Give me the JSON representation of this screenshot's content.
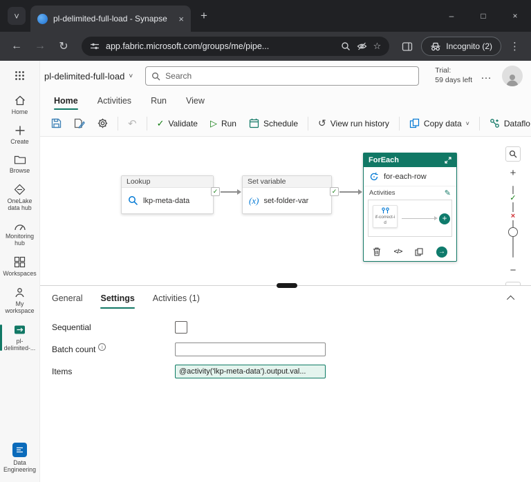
{
  "browser": {
    "tab_title": "pl-delimited-full-load - Synapse",
    "url": "app.fabric.microsoft.com/groups/me/pipe...",
    "incognito_label": "Incognito (2)"
  },
  "icons": {
    "tab_search_chevron": "˅",
    "tab_close": "×",
    "new_tab": "+",
    "window_minimize": "–",
    "window_maximize": "□",
    "window_close": "×",
    "back_arrow": "←",
    "forward_arrow": "→",
    "reload": "↻",
    "bookmark_star": "☆",
    "kebab_menu": "⋮",
    "title_chevron": "˅",
    "more_horizontal": "…",
    "undo": "↶",
    "validate_check": "✓",
    "run_play": "▷",
    "history_clock": "↺",
    "copy_chevron": "˅",
    "edit_pencil": "✎",
    "zoom_in": "+",
    "zoom_out": "−",
    "slider_check": "✓",
    "slider_x": "×",
    "port_check": "✓",
    "inner_plus": "+",
    "iterate_arrow": "→",
    "code_braces": "</>",
    "set_variable_glyph": "(x)",
    "info_i": "i"
  },
  "app_header": {
    "title": "pl-delimited-full-load",
    "search_placeholder": "Search",
    "trial_label": "Trial:",
    "trial_value": "59 days left"
  },
  "ribbon": {
    "tabs": [
      {
        "label": "Home"
      },
      {
        "label": "Activities"
      },
      {
        "label": "Run"
      },
      {
        "label": "View"
      }
    ],
    "validate_label": "Validate",
    "run_label": "Run",
    "schedule_label": "Schedule",
    "history_label": "View run history",
    "copy_data_label": "Copy data",
    "dataflow_label": "Dataflo"
  },
  "sidebar": {
    "items": [
      {
        "label": "Home"
      },
      {
        "label": "Create"
      },
      {
        "label": "Browse"
      },
      {
        "label": "OneLake data hub"
      },
      {
        "label": "Monitoring hub"
      },
      {
        "label": "Workspaces"
      },
      {
        "label": "My workspace"
      },
      {
        "label": "pl-delimited-..."
      }
    ],
    "bottom_label": "Data Engineering"
  },
  "canvas": {
    "lookup": {
      "type": "Lookup",
      "name": "lkp-meta-data"
    },
    "set_variable": {
      "type": "Set variable",
      "name": "set-folder-var"
    },
    "foreach": {
      "type": "ForEach",
      "name": "for-each-row",
      "activities_label": "Activities",
      "inner_activity": "if-correct-id"
    }
  },
  "bottom_panel": {
    "tabs": [
      {
        "label": "General"
      },
      {
        "label": "Settings"
      },
      {
        "label": "Activities (1)"
      }
    ],
    "sequential_label": "Sequential",
    "batch_count_label": "Batch count",
    "items_label": "Items",
    "items_value": "@activity('lkp-meta-data').output.val..."
  }
}
